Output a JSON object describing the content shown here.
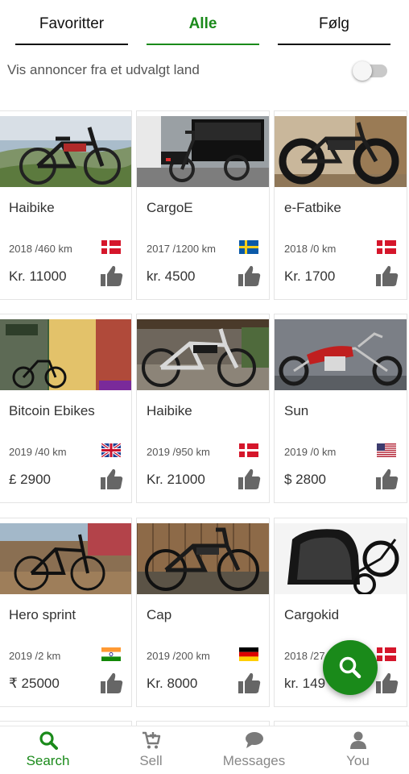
{
  "tabs": [
    {
      "label": "Favoritter",
      "active": false
    },
    {
      "label": "Alle",
      "active": true
    },
    {
      "label": "Følg",
      "active": false
    }
  ],
  "filter": {
    "label": "Vis annoncer fra et udvalgt land",
    "toggle_on": false
  },
  "listings": [
    {
      "title": "Haibike",
      "meta": "2018 /460 km",
      "price": "Kr. 11000",
      "flag": "denmark-flag",
      "photo": "mountain-ebike-photo"
    },
    {
      "title": "CargoE",
      "meta": "2017 /1200 km",
      "price": "kr. 4500",
      "flag": "sweden-flag",
      "photo": "cargo-bike-photo"
    },
    {
      "title": "e-Fatbike",
      "meta": "2018 /0 km",
      "price": "Kr.  1700",
      "flag": "denmark-flag",
      "photo": "fatbike-photo"
    },
    {
      "title": "Bitcoin Ebikes",
      "meta": "2019 /40 km",
      "price": "£ 2900",
      "flag": "uk-flag",
      "photo": "shop-front-photo"
    },
    {
      "title": "Haibike",
      "meta": "2019 /950 km",
      "price": "Kr. 21000",
      "flag": "denmark-flag",
      "photo": "haibike-patio-photo"
    },
    {
      "title": "Sun",
      "meta": "2019 /0 km",
      "price": "$ 2800",
      "flag": "usa-flag",
      "photo": "chopper-motorbike-photo"
    },
    {
      "title": "Hero sprint",
      "meta": "2019 /2 km",
      "price": "₹ 25000",
      "flag": "india-flag",
      "photo": "hero-bike-photo"
    },
    {
      "title": "Cap",
      "meta": "2019 /200 km",
      "price": "Kr. 8000",
      "flag": "germany-flag",
      "photo": "city-ebike-photo"
    },
    {
      "title": "Cargokid",
      "meta": "2018 /27",
      "price": "kr. 149",
      "flag": "denmark-flag",
      "photo": "kid-trailer-photo"
    }
  ],
  "bottom_nav": [
    {
      "label": "Search",
      "icon": "search-icon",
      "active": true
    },
    {
      "label": "Sell",
      "icon": "cart-plus-icon",
      "active": false
    },
    {
      "label": "Messages",
      "icon": "chat-bubble-icon",
      "active": false
    },
    {
      "label": "You",
      "icon": "user-icon",
      "active": false
    }
  ],
  "fab": {
    "icon": "search-icon"
  },
  "colors": {
    "accent": "#1a8a1a",
    "text": "#333333",
    "muted": "#555555",
    "icon_grey": "#666666"
  }
}
